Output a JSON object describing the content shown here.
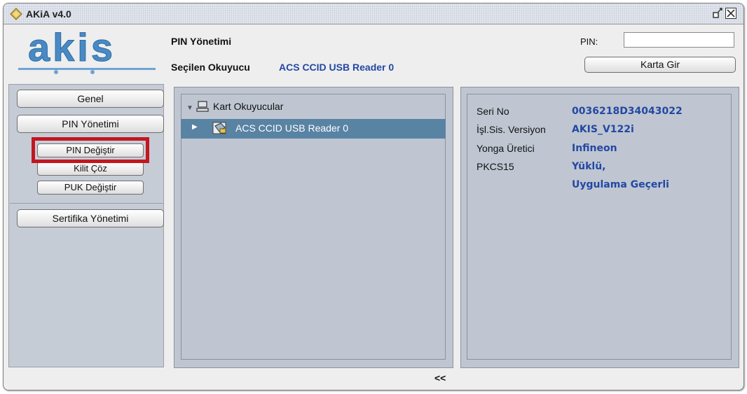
{
  "window": {
    "title": "AKiA v4.0"
  },
  "logo": {
    "text": "akis",
    "color": "#3d7fb8"
  },
  "header": {
    "title": "PIN Yönetimi",
    "reader_label": "Seçilen Okuyucu",
    "reader_value": "ACS CCID USB Reader 0",
    "pin_label": "PIN:",
    "pin_value": "",
    "karta_gir_label": "Karta Gir"
  },
  "sidebar": {
    "genel_label": "Genel",
    "pin_yonetimi_label": "PIN Yönetimi",
    "sub_items": [
      "PIN Değiştir",
      "Kilit Çöz",
      "PUK Değiştir"
    ],
    "sertifika_label": "Sertifika Yönetimi"
  },
  "tree": {
    "root_label": "Kart Okuyucular",
    "selected_label": "ACS CCID USB Reader 0"
  },
  "info": {
    "rows": [
      {
        "label": "Seri No",
        "value": "0036218D34043022"
      },
      {
        "label": "İşl.Sis. Versiyon",
        "value": "AKIS_V122i"
      },
      {
        "label": "Yonga Üretici",
        "value": "Infineon"
      },
      {
        "label": "PKCS15",
        "value": "Yüklü,"
      },
      {
        "label": "",
        "value": "Uygulama Geçerli"
      }
    ]
  },
  "status": {
    "collapse_label": "<<"
  },
  "colors": {
    "accent": "#2348a4",
    "highlight": "#c3161f",
    "selection": "#5983a3",
    "panel": "#bfc6d1"
  }
}
